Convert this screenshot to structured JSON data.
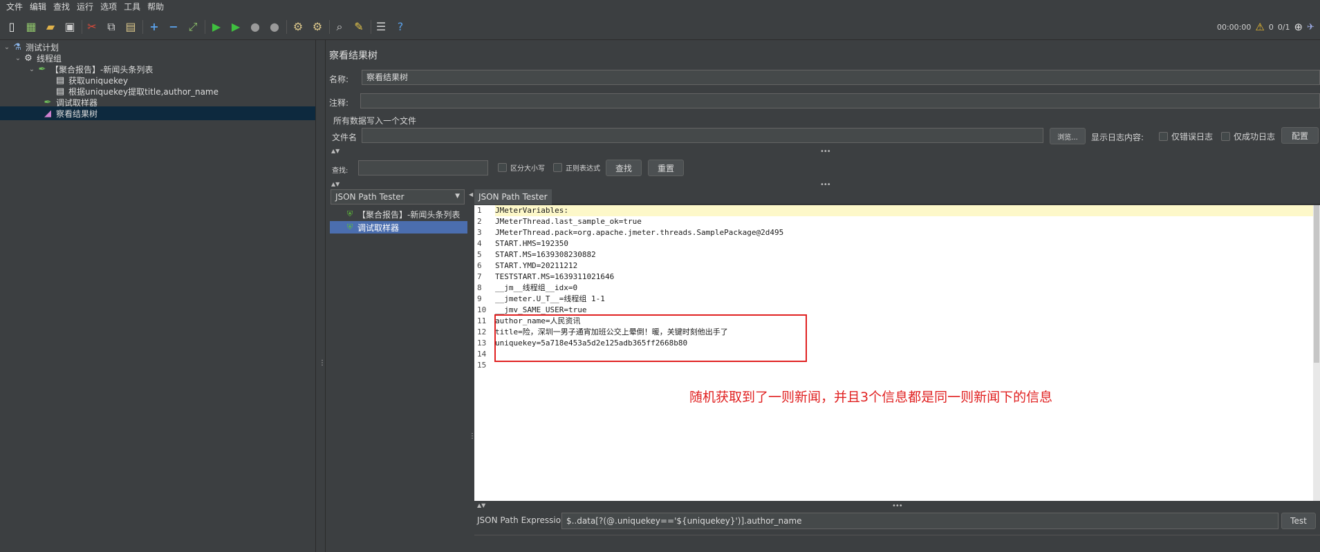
{
  "menu": [
    "文件",
    "编辑",
    "查找",
    "运行",
    "选项",
    "工具",
    "帮助"
  ],
  "toolbar": {
    "timer": "00:00:00",
    "warning_count": "0",
    "thread_ratio": "0/1"
  },
  "tree": [
    {
      "label": "测试计划",
      "icon": "test-plan-icon"
    },
    {
      "label": "线程组",
      "icon": "gear-icon"
    },
    {
      "label": "【聚合报告】-新闻头条列表",
      "icon": "sampler-icon"
    },
    {
      "label": "获取uniquekey",
      "icon": "extractor-icon"
    },
    {
      "label": "根据uniquekey提取title,author_name",
      "icon": "extractor-icon"
    },
    {
      "label": "调试取样器",
      "icon": "sampler-icon"
    },
    {
      "label": "察看结果树",
      "icon": "listener-icon"
    }
  ],
  "config": {
    "title": "察看结果树",
    "name_label": "名称:",
    "name_value": "察看结果树",
    "comment_label": "注释:",
    "file_section_label": "所有数据写入一个文件",
    "filename_label": "文件名",
    "browse_label": "浏览...",
    "log_display_label": "显示日志内容:",
    "errors_only_label": "仅错误日志",
    "success_only_label": "仅成功日志",
    "configure_label": "配置"
  },
  "search": {
    "label": "查找:",
    "case_sensitive_label": "区分大小写",
    "regex_label": "正则表达式",
    "find_label": "查找",
    "reset_label": "重置"
  },
  "results": {
    "renderer": "JSON Path Tester",
    "items": [
      "【聚合报告】-新闻头条列表",
      "调试取样器"
    ]
  },
  "viewer": {
    "tab_label": "JSON Path Tester",
    "lines": [
      "JMeterVariables:",
      "JMeterThread.last_sample_ok=true",
      "JMeterThread.pack=org.apache.jmeter.threads.SamplePackage@2d495",
      "START.HMS=192350",
      "START.MS=1639308230882",
      "START.YMD=20211212",
      "TESTSTART.MS=1639311021646",
      "__jm__线程组__idx=0",
      "__jmeter.U_T__=线程组 1-1",
      "__jmv_SAME_USER=true",
      "author_name=人民资讯",
      "title=险，深圳一男子通宵加班公交上晕倒！暖，关键时刻他出手了",
      "uniquekey=5a718e453a5d2e125adb365ff2668b80",
      "",
      ""
    ],
    "annotation": "随机获取到了一则新闻，并且3个信息都是同一则新闻下的信息",
    "annotation_color": "#e02020"
  },
  "expression": {
    "label": "JSON Path Expression",
    "value": "$..data[?(@.uniquekey=='${uniquekey}')].author_name",
    "test_label": "Test"
  }
}
